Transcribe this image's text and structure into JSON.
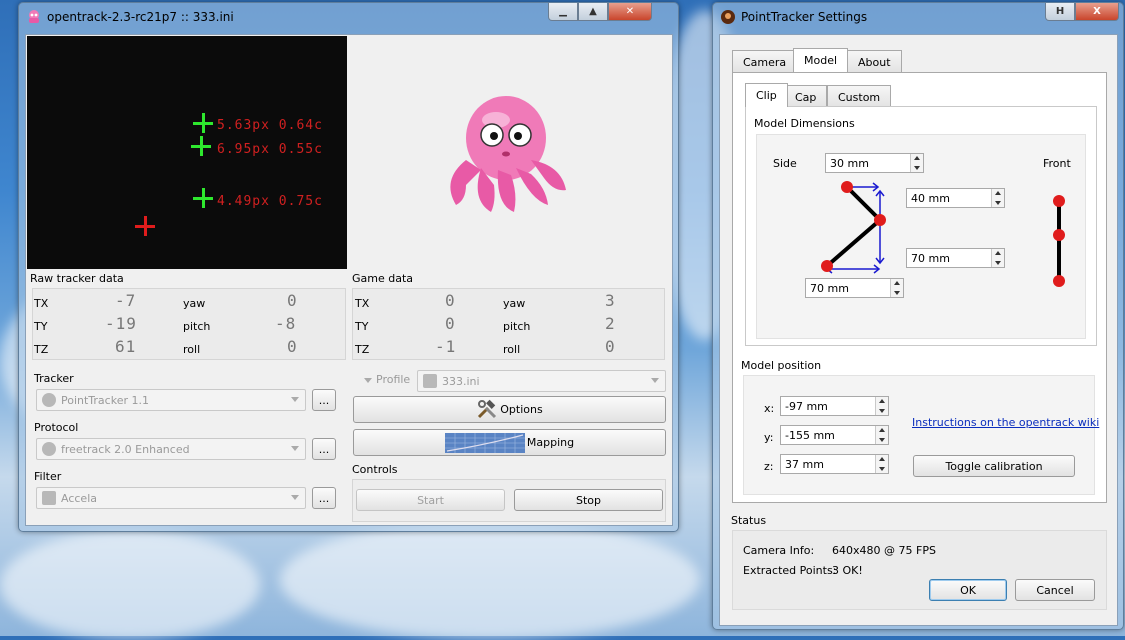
{
  "main_window": {
    "title": "opentrack-2.3-rc21p7 :: 333.ini",
    "video_labels": [
      "5.63px 0.64c",
      "6.95px 0.55c",
      "4.49px 0.75c"
    ],
    "raw_title": "Raw tracker data",
    "game_title": "Game data",
    "raw": {
      "tx_label": "TX",
      "tx": "-7",
      "ty_label": "TY",
      "ty": "-19",
      "tz_label": "TZ",
      "tz": "61",
      "yaw_label": "yaw",
      "yaw": "0",
      "pitch_label": "pitch",
      "pitch": "-8",
      "roll_label": "roll",
      "roll": "0"
    },
    "game": {
      "tx_label": "TX",
      "tx": "0",
      "ty_label": "TY",
      "ty": "0",
      "tz_label": "TZ",
      "tz": "-1",
      "yaw_label": "yaw",
      "yaw": "3",
      "pitch_label": "pitch",
      "pitch": "2",
      "roll_label": "roll",
      "roll": "0"
    },
    "tracker_label": "Tracker",
    "tracker_value": "PointTracker 1.1",
    "protocol_label": "Protocol",
    "protocol_value": "freetrack 2.0 Enhanced",
    "filter_label": "Filter",
    "filter_value": "Accela",
    "ellipsis": "...",
    "profile_label": "Profile",
    "profile_value": "333.ini",
    "options_label": "Options",
    "mapping_label": "Mapping",
    "controls_label": "Controls",
    "start_label": "Start",
    "stop_label": "Stop"
  },
  "settings_window": {
    "title": "PointTracker Settings",
    "title_buttons": [
      "H",
      "X"
    ],
    "tabs": [
      "Camera",
      "Model",
      "About"
    ],
    "subtabs": [
      "Clip",
      "Cap",
      "Custom"
    ],
    "model_dimensions_label": "Model Dimensions",
    "side_label": "Side",
    "front_label": "Front",
    "side_value": "30 mm",
    "dim_a": "40 mm",
    "dim_b": "70 mm",
    "dim_c": "70 mm",
    "model_position_label": "Model position",
    "x_label": "x:",
    "x_value": "-97 mm",
    "y_label": "y:",
    "y_value": "-155 mm",
    "z_label": "z:",
    "z_value": "37 mm",
    "wiki_link": "Instructions on the opentrack wiki",
    "toggle_calibration": "Toggle calibration",
    "status_label": "Status",
    "camera_info_label": "Camera Info:",
    "camera_info_value": "640x480 @ 75 FPS",
    "extracted_label": "Extracted Points:",
    "extracted_value": "3 OK!",
    "ok_label": "OK",
    "cancel_label": "Cancel"
  },
  "colors": {
    "point_green": "#2ee82e",
    "point_red": "#e01c1c",
    "link": "#0a2dbd"
  }
}
